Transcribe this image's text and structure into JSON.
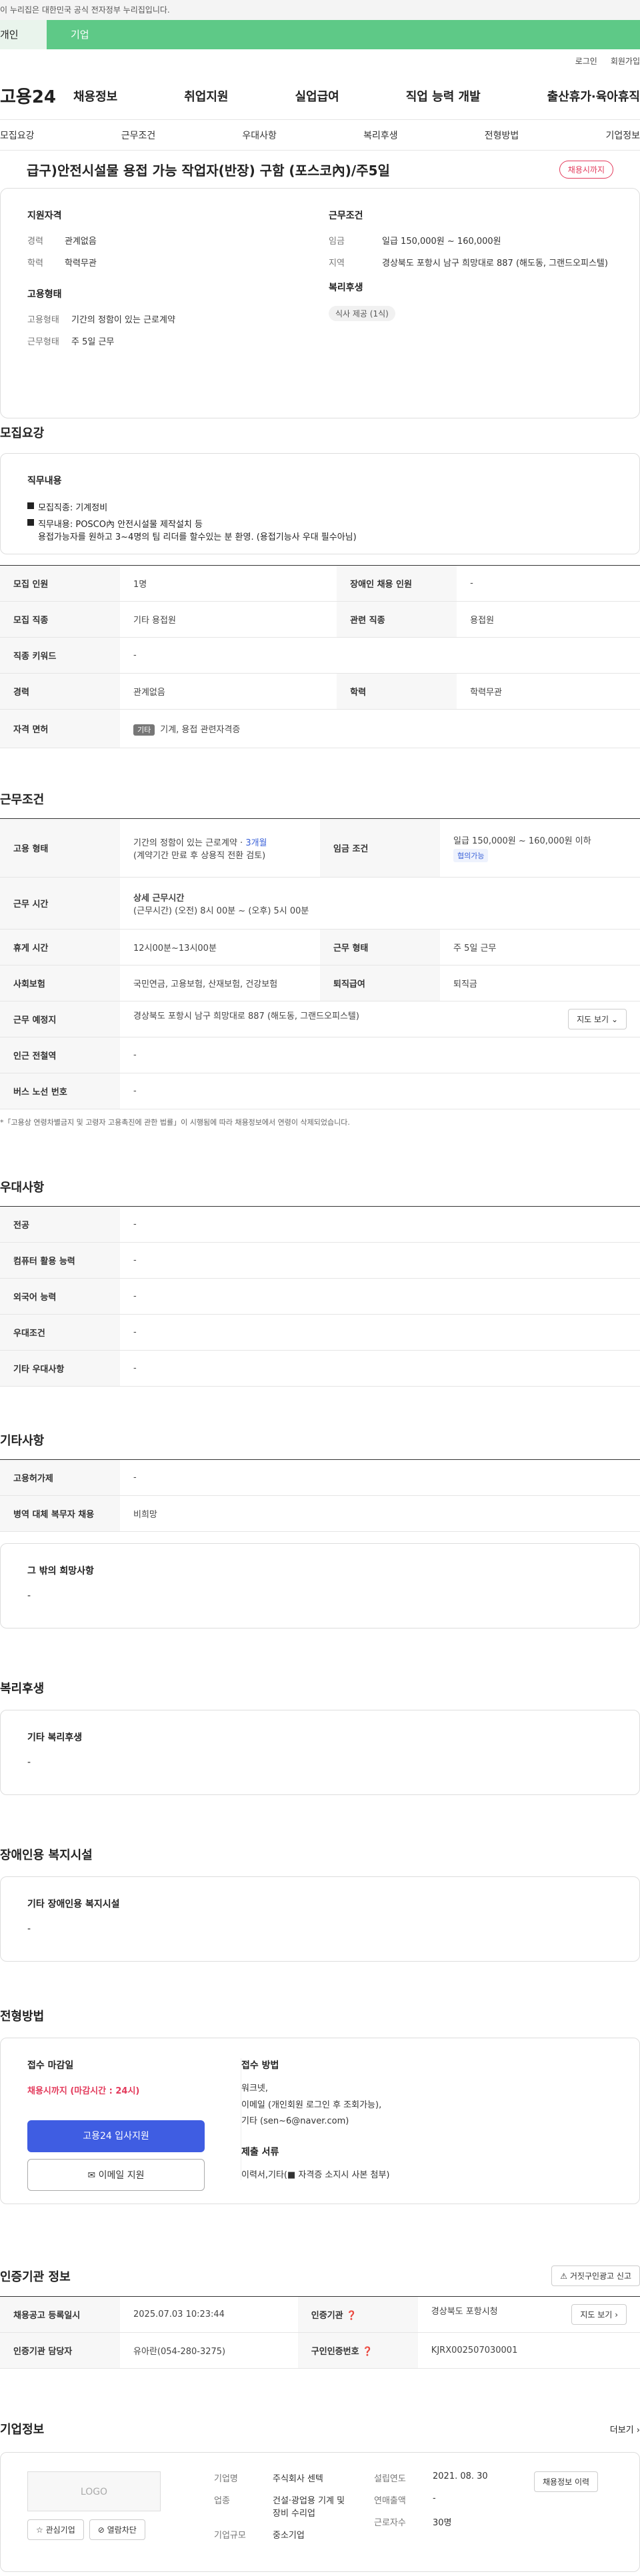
{
  "banner": "이 누리집은 대한민국 공식 전자정부 누리집입니다.",
  "tabs": [
    "개인",
    "기업"
  ],
  "util": [
    "로그인",
    "회원가입"
  ],
  "logo": "고용24",
  "gnb": [
    "채용정보",
    "취업지원",
    "실업급여",
    "직업 능력 개발",
    "출산휴가·육아휴직"
  ],
  "subnav": [
    "모집요강",
    "근무조건",
    "우대사항",
    "복리후생",
    "전형방법",
    "기업정보"
  ],
  "title": "급구)안전시설물 용접 가능 작업자(반장) 구함 (포스코內)/주5일",
  "deadline_badge": "채용시까지",
  "summary": {
    "qual_title": "지원자격",
    "career_k": "경력",
    "career_v": "관계없음",
    "edu_k": "학력",
    "edu_v": "학력무관",
    "emp_title": "고용형태",
    "emptype_k": "고용형태",
    "emptype_v": "기간의 정함이 있는 근로계약",
    "worktype_k": "근무형태",
    "worktype_v": "주 5일 근무",
    "cond_title": "근무조건",
    "wage_k": "임금",
    "wage_v": "일급 150,000원 ~ 160,000원",
    "area_k": "지역",
    "area_v": "경상북도 포항시 남구 희망대로 887 (해도동, 그랜드오피스텔)",
    "welfare_title": "복리후생",
    "welfare_chip": "식사 제공 (1식)"
  },
  "recruit": {
    "title": "모집요강",
    "duty_title": "직무내용",
    "duty": [
      "모집직종: 기계정비",
      "직무내용: POSCO內 안전시설물 제작설치 등\n용접가능자를 원하고 3~4명의 팀 리더를 할수있는 분 환영. (용접기능사 우대 필수아님)"
    ],
    "rows": [
      {
        "k1": "모집 인원",
        "v1": "1명",
        "k2": "장애인 채용 인원",
        "v2": "-"
      },
      {
        "k1": "모집 직종",
        "v1": "기타 용접원",
        "k2": "관련 직종",
        "v2": "용접원"
      },
      {
        "k1": "직종 키워드",
        "v1": "-"
      },
      {
        "k1": "경력",
        "v1": "관계없음",
        "k2": "학력",
        "v2": "학력무관"
      }
    ],
    "license_k": "자격 면허",
    "license_tag": "기타",
    "license_v": "기계, 용접 관련자격증"
  },
  "work": {
    "title": "근무조건",
    "emp_k": "고용 형태",
    "emp_v1": "기간의 정함이 있는 근로계약 · ",
    "emp_months": "3개월",
    "emp_v2": "(계약기간 만료 후 상용직 전환 검토)",
    "wage_k": "임금 조건",
    "wage_v": "일급 150,000원 ~ 160,000원 이하",
    "wage_tag": "협의가능",
    "hours_k": "근무 시간",
    "hours_title": "상세 근무시간",
    "hours_v": "(근무시간) (오전) 8시 00분 ~ (오후) 5시 00분",
    "rest_k": "휴게 시간",
    "rest_v": "12시00분~13시00분",
    "form_k": "근무 형태",
    "form_v": "주 5일 근무",
    "ins_k": "사회보험",
    "ins_v": "국민연금, 고용보험, 산재보험, 건강보험",
    "retire_k": "퇴직급여",
    "retire_v": "퇴직금",
    "place_k": "근무 예정지",
    "place_v": "경상북도 포항시 남구 희망대로 887 (해도동, 그랜드오피스텔)",
    "map_btn": "지도 보기",
    "station_k": "인근 전철역",
    "station_v": "-",
    "bus_k": "버스 노선 번호",
    "bus_v": "-",
    "note": "*「고용상 연령차별금지 및 고령자 고용촉진에 관한 법률」이 시행됨에 따라 채용정보에서 연령이 삭제되었습니다."
  },
  "pref": {
    "title": "우대사항",
    "rows": [
      [
        "전공",
        "-"
      ],
      [
        "컴퓨터 활용 능력",
        "-"
      ],
      [
        "외국어 능력",
        "-"
      ],
      [
        "우대조건",
        "-"
      ],
      [
        "기타 우대사항",
        "-"
      ]
    ]
  },
  "etc": {
    "title": "기타사항",
    "rows": [
      [
        "고용허가제",
        "-"
      ],
      [
        "병역 대체 복무자 채용",
        "비희망"
      ]
    ],
    "box_title": "그 밖의 희망사항",
    "box_v": "-"
  },
  "welfare": {
    "title": "복리후생",
    "box_title": "기타 복리후생",
    "box_v": "-"
  },
  "disabled": {
    "title": "장애인용 복지시설",
    "box_title": "기타 장애인용 복지시설",
    "box_v": "-"
  },
  "select": {
    "title": "전형방법",
    "deadline_title": "접수 마감일",
    "deadline_v": "채용시까지 (마감시간 : 24시)",
    "apply_btn": "고용24 입사지원",
    "email_btn": "이메일 지원",
    "method_title": "접수 방법",
    "method_v": "워크넷,\n이메일 (개인회원 로그인 후 조회가능),\n기타 (sen~6@naver.com)",
    "docs_title": "제출 서류",
    "docs_v": "이력서,기타(■ 자격증 소지시 사본 첨부)"
  },
  "auth": {
    "title": "인증기관 정보",
    "report_btn": "거짓구인광고 신고",
    "reg_k": "채용공고 등록일시",
    "reg_v": "2025.07.03 10:23:44",
    "org_k": "인증기관",
    "org_v": "경상북도 포항시청",
    "map_btn": "지도 보기",
    "mgr_k": "인증기관 담당자",
    "mgr_v": "유아란(054-280-3275)",
    "num_k": "구인인증번호",
    "num_v": "KJRX002507030001"
  },
  "company": {
    "title": "기업정보",
    "more": "더보기",
    "logo": "LOGO",
    "fav": "관심기업",
    "block": "열람차단",
    "name_k": "기업명",
    "name_v": "주식회사 센텍",
    "biz_k": "업종",
    "biz_v": "건설·광업용 기계 및 장비 수리업",
    "size_k": "기업규모",
    "size_v": "중소기업",
    "year_k": "설립연도",
    "year_v": "2021. 08. 30",
    "sales_k": "연매출액",
    "sales_v": "-",
    "emp_k": "근로자수",
    "emp_v": "30명",
    "history_btn": "채용정보 이력"
  }
}
